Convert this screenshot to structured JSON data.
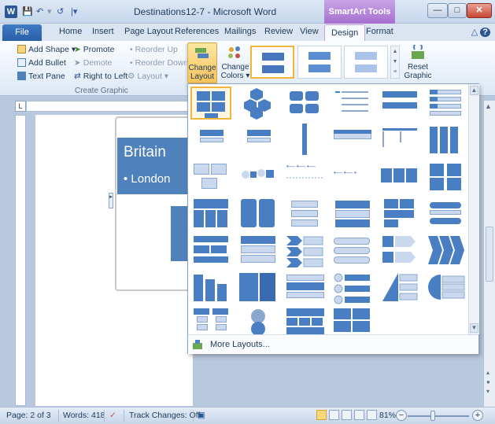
{
  "window": {
    "title": "Destinations12-7 - Microsoft Word",
    "contextual_group": "SmartArt Tools",
    "app_icon_letter": "W"
  },
  "tabs": [
    {
      "label": "File"
    },
    {
      "label": "Home"
    },
    {
      "label": "Insert"
    },
    {
      "label": "Page Layout"
    },
    {
      "label": "References"
    },
    {
      "label": "Mailings"
    },
    {
      "label": "Review"
    },
    {
      "label": "View"
    },
    {
      "label": "Design"
    },
    {
      "label": "Format"
    }
  ],
  "ribbon": {
    "create_graphic": {
      "add_shape": "Add Shape",
      "add_bullet": "Add Bullet",
      "text_pane": "Text Pane",
      "promote": "Promote",
      "demote": "Demote",
      "right_to_left": "Right to Left",
      "reorder_up": "Reorder Up",
      "reorder_down": "Reorder Down",
      "layout": "Layout",
      "group_label": "Create Graphic"
    },
    "change_layout": {
      "line1": "Change",
      "line2": "Layout ▾"
    },
    "change_colors": {
      "line1": "Change",
      "line2": "Colors ▾"
    },
    "reset_graphic": {
      "line1": "Reset",
      "line2": "Graphic"
    }
  },
  "document": {
    "smartart_title": "Britain",
    "smartart_bullet": "• London"
  },
  "layout_gallery": {
    "more_layouts": "More Layouts..."
  },
  "statusbar": {
    "page": "Page: 2 of 3",
    "words": "Words: 418",
    "track_changes": "Track Changes: Off",
    "zoom": "81%"
  },
  "colors": {
    "accent": "#4f81bd",
    "selection": "#f1b53c",
    "contextual_tab": "#a66fcf"
  }
}
